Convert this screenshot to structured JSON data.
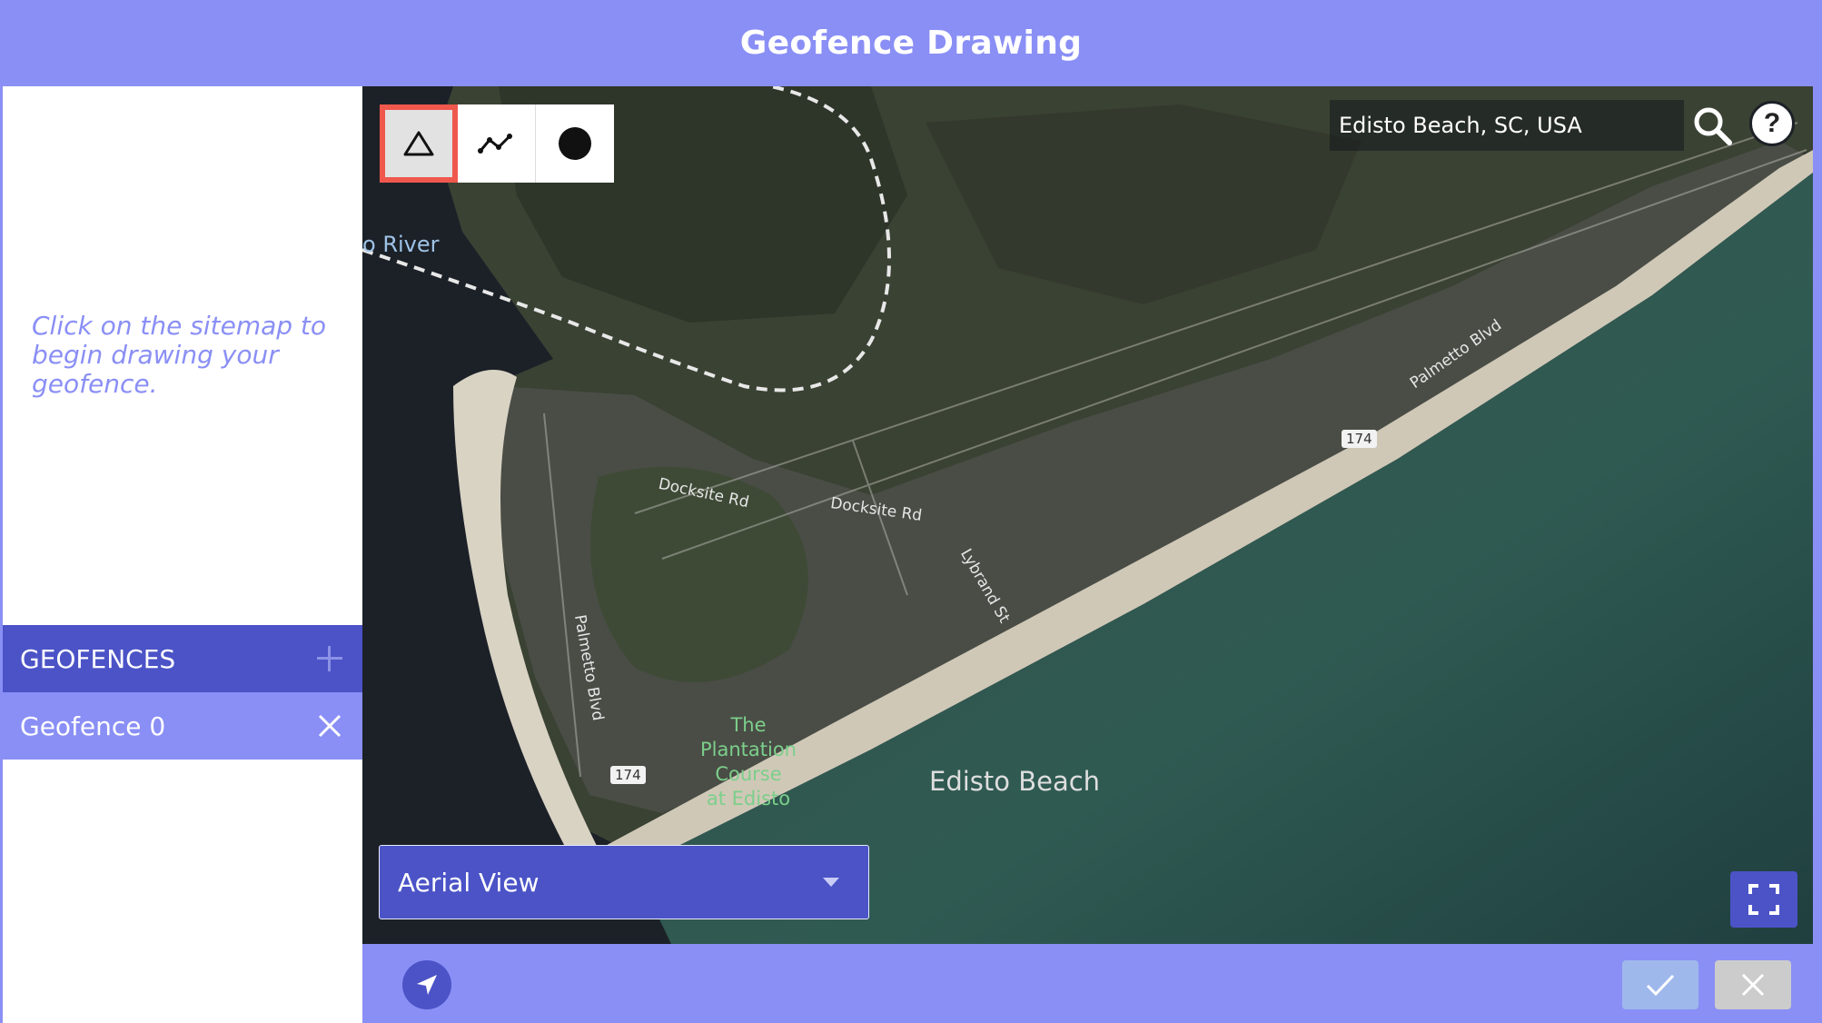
{
  "header": {
    "title": "Geofence Drawing"
  },
  "sidebar": {
    "hint": "Click on the sitemap to begin drawing your geofence.",
    "geofences_label": "GEOFENCES",
    "items": [
      {
        "label": "Geofence 0"
      }
    ]
  },
  "toolbar": {
    "tools": [
      {
        "icon": "triangle-icon",
        "active": true
      },
      {
        "icon": "polyline-icon",
        "active": false
      },
      {
        "icon": "circle-icon",
        "active": false
      }
    ]
  },
  "search": {
    "value": "Edisto Beach, SC, USA"
  },
  "map": {
    "labels": {
      "river": "o River",
      "dockside1": "Docksite Rd",
      "dockside2": "Docksite Rd",
      "lybrand": "Lybrand St",
      "palmetto_left": "Palmetto Blvd",
      "palmetto_right": "Palmetto Blvd",
      "route_top": "174",
      "route_bottom": "174",
      "course_1": "The",
      "course_2": "Plantation",
      "course_3": "Course",
      "course_4": "at Edisto",
      "town": "Edisto Beach"
    }
  },
  "view_select": {
    "value": "Aerial View"
  },
  "colors": {
    "brand": "#8a8ff5",
    "brand_dark": "#4b53c7",
    "active_tool_outline": "#f0574d"
  }
}
